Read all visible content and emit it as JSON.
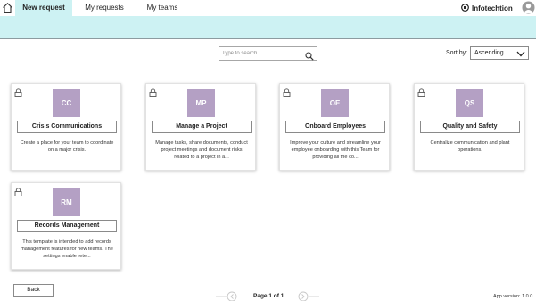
{
  "nav": {
    "tabs": [
      {
        "label": "New request",
        "active": true
      },
      {
        "label": "My requests",
        "active": false
      },
      {
        "label": "My teams",
        "active": false
      }
    ],
    "brand": "Infotechtion"
  },
  "search": {
    "placeholder": "Type to search",
    "value": ""
  },
  "sort": {
    "label": "Sort by:",
    "value": "Ascending"
  },
  "templates": [
    {
      "initials": "CC",
      "title": "Crisis Communications",
      "description": "Create a place for your team to coordinate on a major crisis.",
      "locked": true
    },
    {
      "initials": "MP",
      "title": "Manage a Project",
      "description": "Manage tasks, share documents, conduct project meetings and document risks related to a project in a...",
      "locked": true
    },
    {
      "initials": "OE",
      "title": "Onboard Employees",
      "description": "Improve your culture and streamline your employee onboarding with this Team for providing all the co...",
      "locked": true
    },
    {
      "initials": "QS",
      "title": "Quality and Safety",
      "description": "Centralize communication and plant operations.",
      "locked": true
    },
    {
      "initials": "RM",
      "title": "Records Management",
      "description": "This template is intended to add records management features for new teams. The settings enable rete...",
      "locked": true
    }
  ],
  "footer": {
    "back_label": "Back",
    "page_info": "Page 1 of 1",
    "app_version": "App version: 1.0.0"
  },
  "colors": {
    "accent_band": "#cdf2f3",
    "badge": "#b4a0c4"
  },
  "icons": {
    "home": "home-icon",
    "brand": "infotechtion-logo-icon",
    "avatar": "user-avatar-icon",
    "search": "search-icon",
    "sort": "chevron-down-icon",
    "lock": "lock-icon",
    "prev": "chevron-left-icon",
    "next": "chevron-right-icon"
  }
}
